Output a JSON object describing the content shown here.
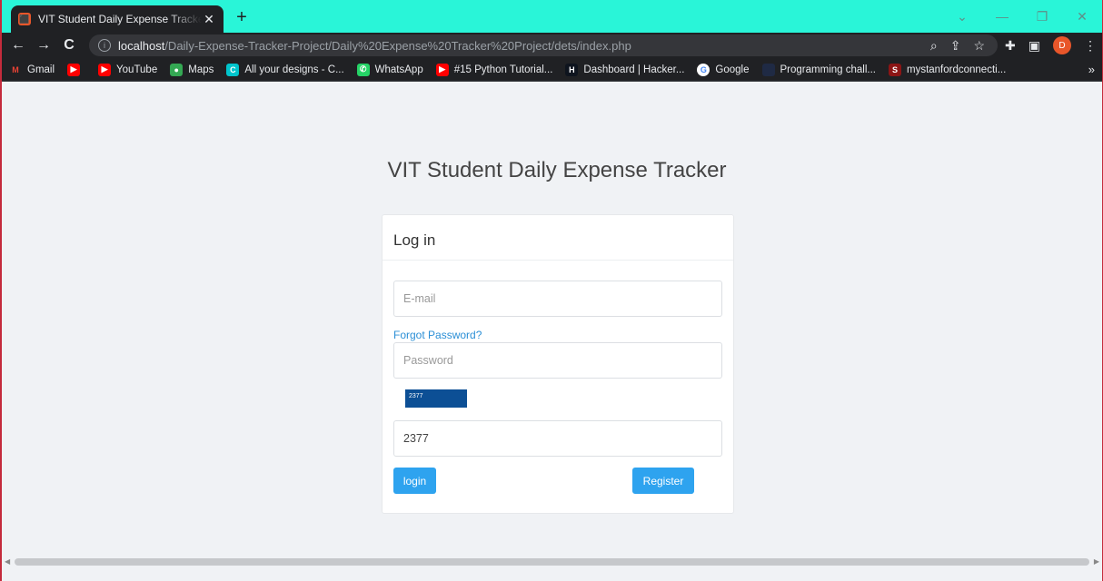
{
  "browser": {
    "tab_title": "VIT Student Daily Expense Tracker",
    "tab_close": "✕",
    "new_tab": "+",
    "window_controls": {
      "minimize": "—",
      "restore": "❐",
      "close": "✕",
      "dropdown": "⌄"
    },
    "url_host": "localhost",
    "url_path": "/Daily-Expense-Tracker-Project/Daily%20Expense%20Tracker%20Project/dets/index.php",
    "nav": {
      "back": "←",
      "forward": "→",
      "reload": "C"
    },
    "profile_initial": "D",
    "bookmarks": [
      {
        "label": "Gmail",
        "icon": "gmail-icon",
        "color": "#ea4335",
        "glyph": "M"
      },
      {
        "label": "",
        "icon": "youtube-icon",
        "color": "#ff0000",
        "glyph": "▶"
      },
      {
        "label": "YouTube",
        "icon": "youtube-icon",
        "color": "#ff0000",
        "glyph": "▶"
      },
      {
        "label": "Maps",
        "icon": "maps-icon",
        "color": "#34a853",
        "glyph": "●"
      },
      {
        "label": "All your designs - C...",
        "icon": "canva-icon",
        "color": "#00c4cc",
        "glyph": "C"
      },
      {
        "label": "WhatsApp",
        "icon": "whatsapp-icon",
        "color": "#25d366",
        "glyph": "✆"
      },
      {
        "label": "#15 Python Tutorial...",
        "icon": "youtube-icon",
        "color": "#ff0000",
        "glyph": "▶"
      },
      {
        "label": "Dashboard | Hacker...",
        "icon": "hackerrank-icon",
        "color": "#0e141e",
        "glyph": "H"
      },
      {
        "label": "Google",
        "icon": "google-icon",
        "color": "#ffffff",
        "glyph": "G"
      },
      {
        "label": "Programming chall...",
        "icon": "site-icon",
        "color": "#1f2a44",
        "glyph": ""
      },
      {
        "label": "mystanfordconnecti...",
        "icon": "stanford-icon",
        "color": "#8c1515",
        "glyph": "S"
      }
    ],
    "bookmarks_more": "»"
  },
  "page": {
    "title": "VIT Student Daily Expense Tracker",
    "card_title": "Log in",
    "email_placeholder": "E-mail",
    "forgot_link": "Forgot Password?",
    "password_placeholder": "Password",
    "captcha_text": "2377",
    "captcha_input_value": "2377",
    "login_button": "login",
    "register_button": "Register"
  }
}
